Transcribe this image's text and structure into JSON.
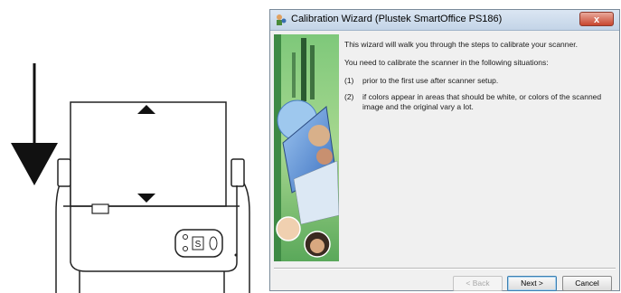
{
  "window": {
    "title": "Calibration Wizard (Plustek SmartOffice PS186)",
    "close_label": "x"
  },
  "content": {
    "intro": "This wizard will walk you through the steps to calibrate your scanner.",
    "situations_heading": "You need to calibrate the scanner in the following situations:",
    "items": [
      {
        "num": "(1)",
        "text": "prior to the first use after scanner setup."
      },
      {
        "num": "(2)",
        "text": "if colors appear in areas that should be white, or colors of the scanned image and the original vary a lot."
      }
    ]
  },
  "buttons": {
    "back": "< Back",
    "next": "Next >",
    "cancel": "Cancel"
  },
  "illustration": {
    "scanner_button_label": "S"
  }
}
